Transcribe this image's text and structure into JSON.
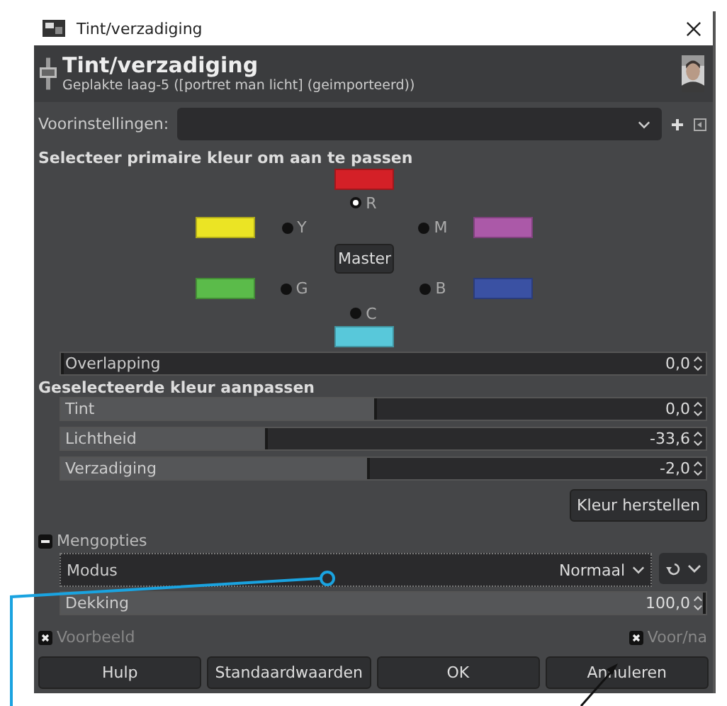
{
  "window": {
    "title": "Tint/verzadiging"
  },
  "header": {
    "title": "Tint/verzadiging",
    "subtitle": "Geplakte laag-5 ([portret man licht] (geimporteerd))"
  },
  "presets": {
    "label": "Voorinstellingen:"
  },
  "primary": {
    "heading": "Selecteer primaire kleur om aan te passen",
    "master": "Master",
    "colors": [
      {
        "label": "R",
        "color": "#d42027",
        "selected": true
      },
      {
        "label": "Y",
        "color": "#ebe424",
        "selected": false
      },
      {
        "label": "M",
        "color": "#ab59a8",
        "selected": false
      },
      {
        "label": "G",
        "color": "#5bbb4a",
        "selected": false
      },
      {
        "label": "B",
        "color": "#3a51a3",
        "selected": false
      },
      {
        "label": "C",
        "color": "#58c8da",
        "selected": false
      }
    ]
  },
  "overlap": {
    "label": "Overlapping",
    "reading": "0,0",
    "level": 0
  },
  "adjust": {
    "heading": "Geselecteerde kleur aanpassen",
    "sliders": [
      {
        "label": "Tint",
        "reading": "0,0",
        "level": 0.49
      },
      {
        "label": "Lichtheid",
        "reading": "-33,6",
        "level": 0.32
      },
      {
        "label": "Verzadiging",
        "reading": "-2,0",
        "level": 0.48
      }
    ],
    "reset": "Kleur herstellen"
  },
  "blend": {
    "label": "Mengopties",
    "expanded": true,
    "mode_label": "Modus",
    "mode_value": "Normaal",
    "opacity": {
      "label": "Dekking",
      "reading": "100,0",
      "level": 1
    }
  },
  "preview": {
    "label": "Voorbeeld",
    "checked": true
  },
  "split": {
    "label": "Voor/na",
    "checked": true
  },
  "buttons": [
    "Hulp",
    "Standaardwaarden",
    "OK",
    "Annuleren"
  ]
}
